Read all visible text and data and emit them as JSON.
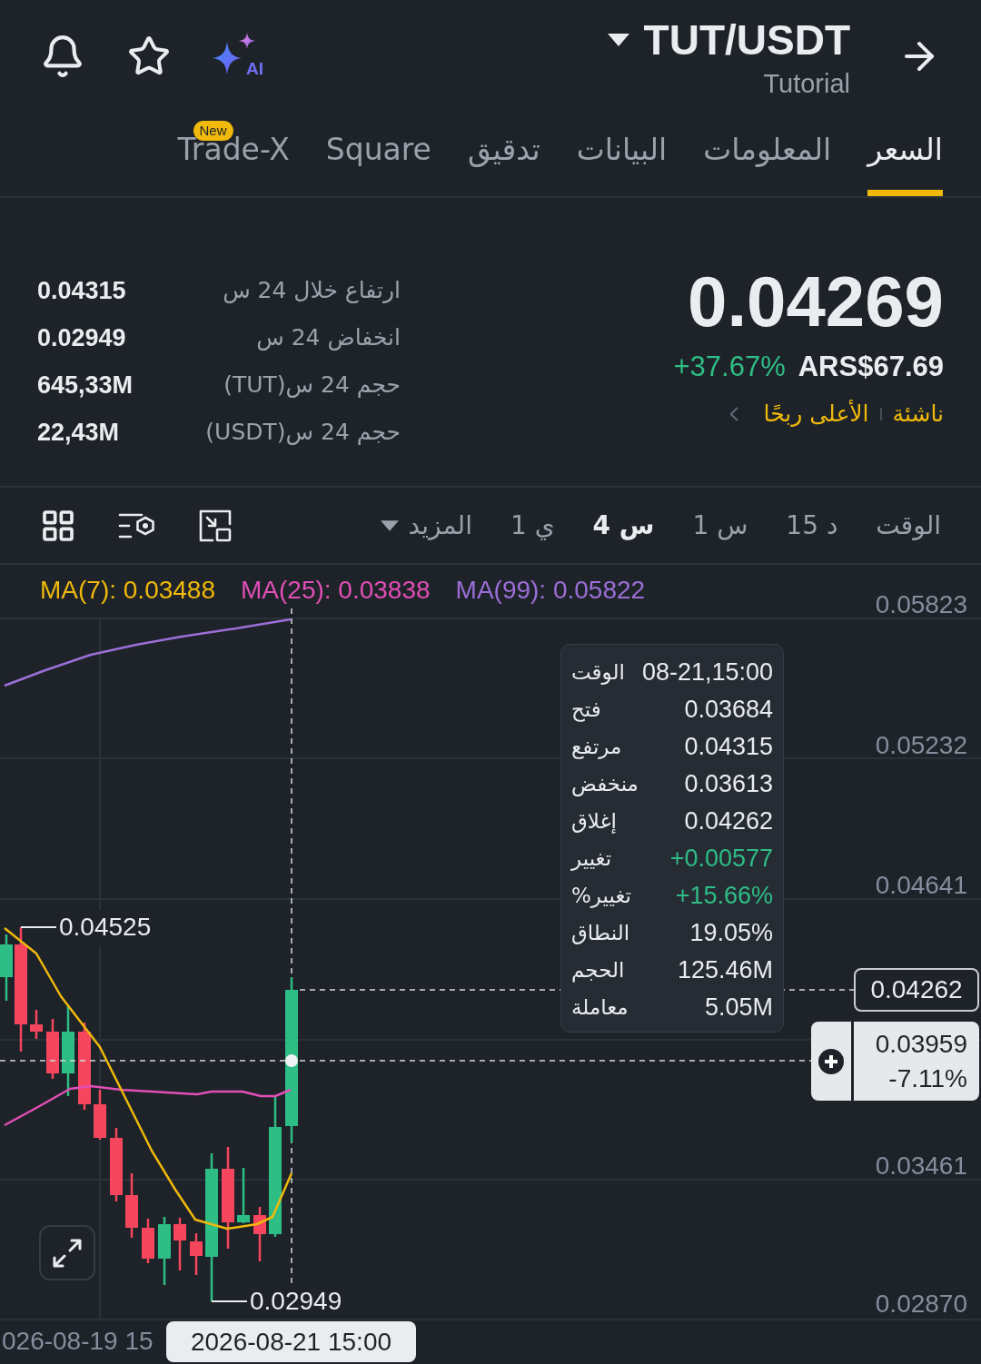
{
  "header": {
    "pair": "TUT/USDT",
    "subtitle": "Tutorial",
    "ai_label": "AI"
  },
  "tabs": [
    {
      "label": "السعر",
      "selected": true
    },
    {
      "label": "المعلومات",
      "selected": false
    },
    {
      "label": "البيانات",
      "selected": false
    },
    {
      "label": "تدقيق",
      "selected": false
    },
    {
      "label": "Square",
      "selected": false
    },
    {
      "label": "Trade-X",
      "selected": false,
      "badge": "New"
    }
  ],
  "ticker": {
    "price": "0.04269",
    "change": "+37.67%",
    "fiat_price": "ARS$67.69",
    "tags": [
      "ناشئة",
      "الأعلى ربحًا"
    ]
  },
  "stats": [
    {
      "label": "ارتفاع خلال 24 س",
      "value": "0.04315"
    },
    {
      "label": "انخفاض 24 س",
      "value": "0.02949"
    },
    {
      "label": "حجم 24 س(TUT)",
      "value": "645,33M"
    },
    {
      "label": "حجم 24 س(USDT)",
      "value": "22,43M"
    }
  ],
  "timeframes": {
    "options": [
      {
        "label": "الوقت",
        "selected": false
      },
      {
        "label": "15 د",
        "selected": false
      },
      {
        "label": "1 س",
        "selected": false
      },
      {
        "label": "4 س",
        "selected": true
      },
      {
        "label": "1 ي",
        "selected": false
      }
    ],
    "more": "المزيد"
  },
  "chart": {
    "indicators": [
      {
        "label": "MA(99): 0.05822",
        "color": "#9c6fd8"
      },
      {
        "label": "MA(25): 0.03838",
        "color": "#e24fb6"
      },
      {
        "label": "MA(7): 0.03488",
        "color": "#f0b90b"
      }
    ],
    "price_axis": [
      "0.05823",
      "0.05232",
      "0.04641",
      "0.03461",
      "0.02870"
    ],
    "time_axis": [
      "026-08-19 15"
    ],
    "high_marker": "0.04525",
    "low_marker": "0.02949",
    "last_price": "0.04262",
    "crosshair": {
      "price": "0.03959",
      "change": "-7.11%",
      "time": "2026-08-21 15:00"
    },
    "tooltip": [
      {
        "label": "الوقت",
        "value": "08-21,15:00",
        "kind": "plain"
      },
      {
        "label": "فتح",
        "value": "0.03684",
        "kind": "plain"
      },
      {
        "label": "مرتفع",
        "value": "0.04315",
        "kind": "plain"
      },
      {
        "label": "منخفض",
        "value": "0.03613",
        "kind": "plain"
      },
      {
        "label": "إغلاق",
        "value": "0.04262",
        "kind": "plain"
      },
      {
        "label": "تغيير",
        "value": "+0.00577",
        "kind": "up"
      },
      {
        "label": "تغيير%",
        "value": "+15.66%",
        "kind": "up"
      },
      {
        "label": "النطاق",
        "value": "19.05%",
        "kind": "plain"
      },
      {
        "label": "الحجم",
        "value": "125.46M",
        "kind": "plain"
      },
      {
        "label": "معاملة",
        "value": "5.05M",
        "kind": "plain"
      }
    ]
  }
}
